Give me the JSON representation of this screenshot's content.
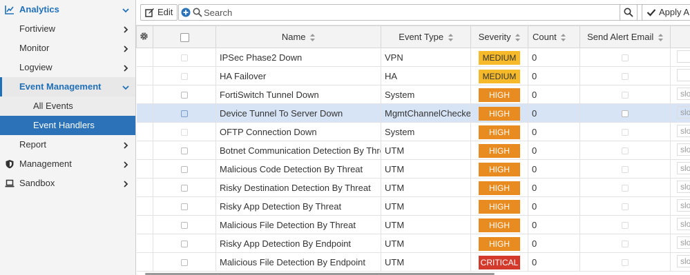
{
  "sidebar": {
    "analytics": "Analytics",
    "fortiview": "Fortiview",
    "monitor": "Monitor",
    "logview": "Logview",
    "event_management": "Event Management",
    "all_events": "All Events",
    "event_handlers": "Event Handlers",
    "report": "Report",
    "management": "Management",
    "sandbox": "Sandbox"
  },
  "toolbar": {
    "edit_label": "Edit",
    "search_placeholder": "Search",
    "apply_label": "Apply All"
  },
  "table": {
    "columns": {
      "name": "Name",
      "event_type": "Event Type",
      "severity": "Severity",
      "count": "Count",
      "send_alert_email": "Send Alert Email"
    },
    "rows": [
      {
        "name": "IPSec Phase2 Down",
        "type": "VPN",
        "severity": "MEDIUM",
        "count": "0",
        "slo": ""
      },
      {
        "name": "HA Failover",
        "type": "HA",
        "severity": "MEDIUM",
        "count": "0",
        "slo": ""
      },
      {
        "name": "FortiSwitch Tunnel Down",
        "type": "System",
        "severity": "HIGH",
        "count": "0",
        "slo": "slo"
      },
      {
        "name": "Device Tunnel To Server Down",
        "type": "MgmtChannelChecker",
        "severity": "HIGH",
        "count": "0",
        "slo": "slo"
      },
      {
        "name": "OFTP Connection Down",
        "type": "System",
        "severity": "HIGH",
        "count": "0",
        "slo": "slo"
      },
      {
        "name": "Botnet Communication Detection By Threat",
        "type": "UTM",
        "severity": "HIGH",
        "count": "0",
        "slo": "slo"
      },
      {
        "name": "Malicious Code Detection By Threat",
        "type": "UTM",
        "severity": "HIGH",
        "count": "0",
        "slo": "slo"
      },
      {
        "name": "Risky Destination Detection By Threat",
        "type": "UTM",
        "severity": "HIGH",
        "count": "0",
        "slo": "slo"
      },
      {
        "name": "Risky App Detection By Threat",
        "type": "UTM",
        "severity": "HIGH",
        "count": "0",
        "slo": "slo"
      },
      {
        "name": "Malicious File Detection By Threat",
        "type": "UTM",
        "severity": "HIGH",
        "count": "0",
        "slo": "slo"
      },
      {
        "name": "Risky App Detection By Endpoint",
        "type": "UTM",
        "severity": "HIGH",
        "count": "0",
        "slo": "slo"
      },
      {
        "name": "Malicious File Detection By Endpoint",
        "type": "UTM",
        "severity": "CRITICAL",
        "count": "0",
        "slo": "slo"
      }
    ]
  },
  "colors": {
    "accent": "#2070b8",
    "selected_nav": "#2b72b8",
    "selected_row": "#d6e4f6",
    "severity_medium": "#f5b929",
    "severity_high": "#e88b20",
    "severity_critical": "#d33a2c"
  },
  "icons": {
    "analytics": "line-chart-icon",
    "management": "shield-icon",
    "sandbox": "laptop-icon",
    "edit": "edit-icon",
    "add": "plus-circle-icon",
    "search": "search-icon",
    "apply": "checkmark-icon",
    "settings": "gear-icon"
  }
}
